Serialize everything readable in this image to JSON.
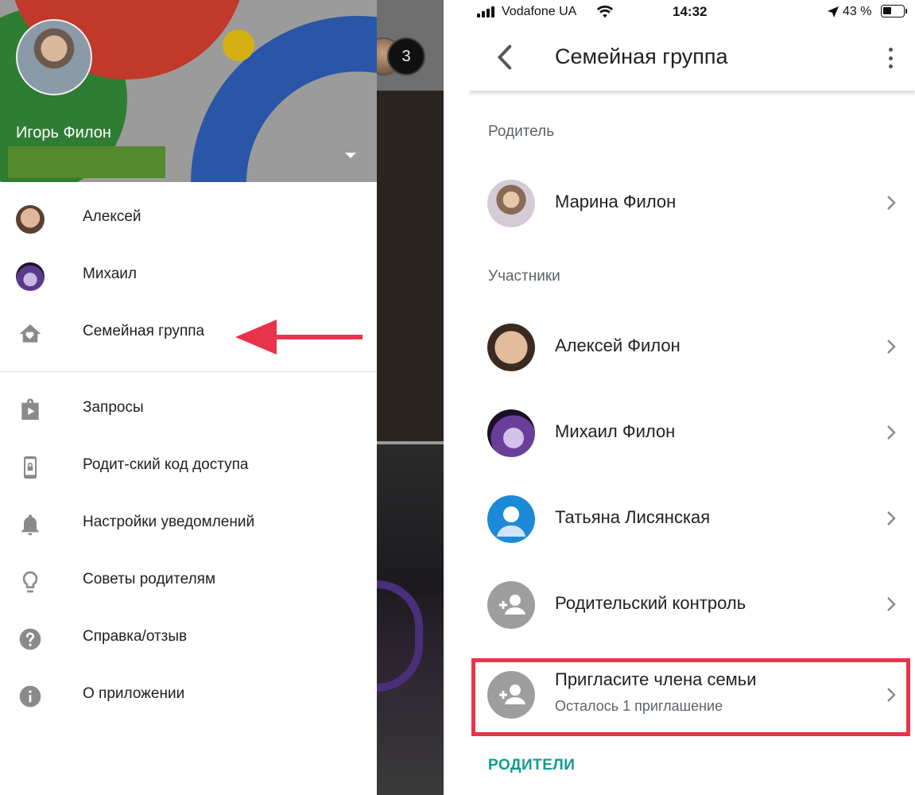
{
  "left": {
    "backdrop_badge": "3",
    "profile": {
      "name": "Игорь Филон"
    },
    "menu": [
      {
        "label": "Алексей",
        "icon": "avatar-alexey"
      },
      {
        "label": "Михаил",
        "icon": "avatar-mikhail"
      },
      {
        "label": "Семейная группа",
        "icon": "home-heart-icon"
      },
      {
        "label": "Запросы",
        "icon": "play-bag-icon"
      },
      {
        "label": "Родит-ский код доступа",
        "icon": "phone-lock-icon"
      },
      {
        "label": "Настройки уведомлений",
        "icon": "bell-icon"
      },
      {
        "label": "Советы родителям",
        "icon": "lightbulb-icon"
      },
      {
        "label": "Справка/отзыв",
        "icon": "help-icon"
      },
      {
        "label": "О приложении",
        "icon": "info-icon"
      }
    ],
    "arrow_color": "#e8334a"
  },
  "right": {
    "status": {
      "carrier": "Vodafone UA",
      "time": "14:32",
      "battery": "43 %"
    },
    "title": "Семейная группа",
    "sections": {
      "parent_label": "Родитель",
      "members_label": "Участники"
    },
    "parent": {
      "name": "Марина Филон"
    },
    "members": [
      {
        "name": "Алексей Филон"
      },
      {
        "name": "Михаил Филон"
      },
      {
        "name": "Татьяна Лисянская"
      },
      {
        "name": "Родительский контроль"
      }
    ],
    "invite": {
      "title": "Пригласите члена семьи",
      "subtitle": "Осталось 1 приглашение"
    },
    "parents_link": "РОДИТЕЛИ",
    "highlight_color": "#e8334a",
    "accent_color": "#0f9d8a"
  }
}
